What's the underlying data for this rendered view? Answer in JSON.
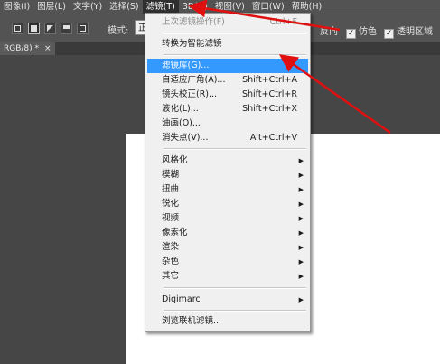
{
  "menubar": {
    "items": [
      {
        "label": "图像(I)"
      },
      {
        "label": "图层(L)"
      },
      {
        "label": "文字(Y)"
      },
      {
        "label": "选择(S)"
      },
      {
        "label": "滤镜(T)"
      },
      {
        "label": "3D(D)"
      },
      {
        "label": "视图(V)"
      },
      {
        "label": "窗口(W)"
      },
      {
        "label": "帮助(H)"
      }
    ]
  },
  "options": {
    "mode_label": "模式:",
    "mode_value": "正",
    "reverse": "反向",
    "dither": "仿色",
    "transparency": "透明区域"
  },
  "document": {
    "tab_title": "RGB/8) *",
    "close": "×"
  },
  "filter_menu": {
    "last_filter": {
      "label": "上次滤镜操作(F)",
      "shortcut": "Ctrl+F"
    },
    "smart": {
      "label": "转换为智能滤镜"
    },
    "gallery": {
      "label": "滤镜库(G)..."
    },
    "adaptive": {
      "label": "自适应广角(A)...",
      "shortcut": "Shift+Ctrl+A"
    },
    "lens": {
      "label": "镜头校正(R)...",
      "shortcut": "Shift+Ctrl+R"
    },
    "liquify": {
      "label": "液化(L)...",
      "shortcut": "Shift+Ctrl+X"
    },
    "oil": {
      "label": "油画(O)..."
    },
    "vanishing": {
      "label": "消失点(V)...",
      "shortcut": "Alt+Ctrl+V"
    },
    "groups": [
      {
        "label": "风格化"
      },
      {
        "label": "模糊"
      },
      {
        "label": "扭曲"
      },
      {
        "label": "锐化"
      },
      {
        "label": "视频"
      },
      {
        "label": "像素化"
      },
      {
        "label": "渲染"
      },
      {
        "label": "杂色"
      },
      {
        "label": "其它"
      }
    ],
    "digimarc": {
      "label": "Digimarc"
    },
    "browse": {
      "label": "浏览联机滤镜..."
    },
    "submenu_arrow": "▶"
  },
  "colors": {
    "highlight": "#3399ff",
    "annotation": "#e01010"
  }
}
